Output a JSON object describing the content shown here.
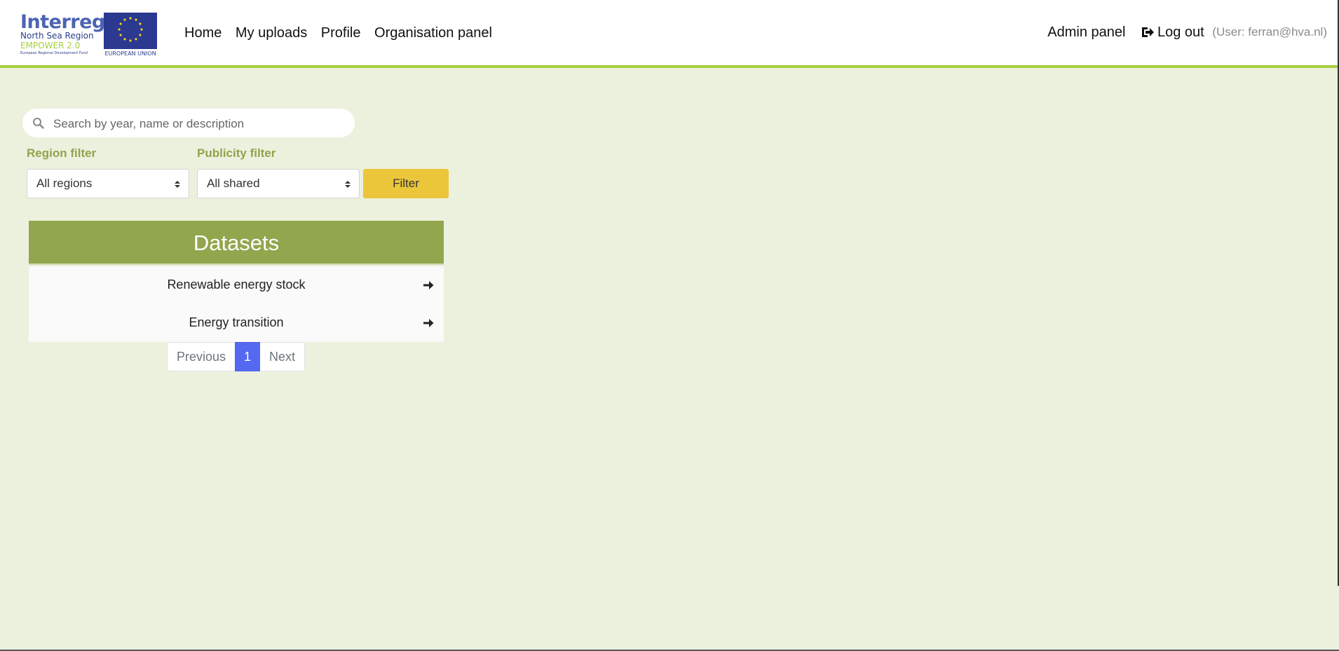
{
  "logo": {
    "interreg": "Interreg",
    "region": "North Sea Region",
    "program": "EMPOWER 2.0",
    "fund": "European Regional Development Fund",
    "eu": "EUROPEAN UNION"
  },
  "nav": {
    "home": "Home",
    "uploads": "My uploads",
    "profile": "Profile",
    "organisation": "Organisation panel",
    "admin": "Admin panel",
    "logout": "Log out",
    "user": "(User: ferran@hva.nl)"
  },
  "search": {
    "placeholder": "Search by year, name or description"
  },
  "filters": {
    "region_label": "Region filter",
    "region_value": "All regions",
    "publicity_label": "Publicity filter",
    "publicity_value": "All shared",
    "button": "Filter"
  },
  "datasets": {
    "title": "Datasets",
    "items": [
      {
        "name": "Renewable energy stock"
      },
      {
        "name": "Energy transition"
      }
    ]
  },
  "pagination": {
    "previous": "Previous",
    "current": "1",
    "next": "Next"
  },
  "colors": {
    "background": "#ecf1de",
    "accent_green": "#92a64d",
    "header_border": "#a6cf3f",
    "filter_button": "#ebc63b",
    "page_active": "#5468f0"
  }
}
